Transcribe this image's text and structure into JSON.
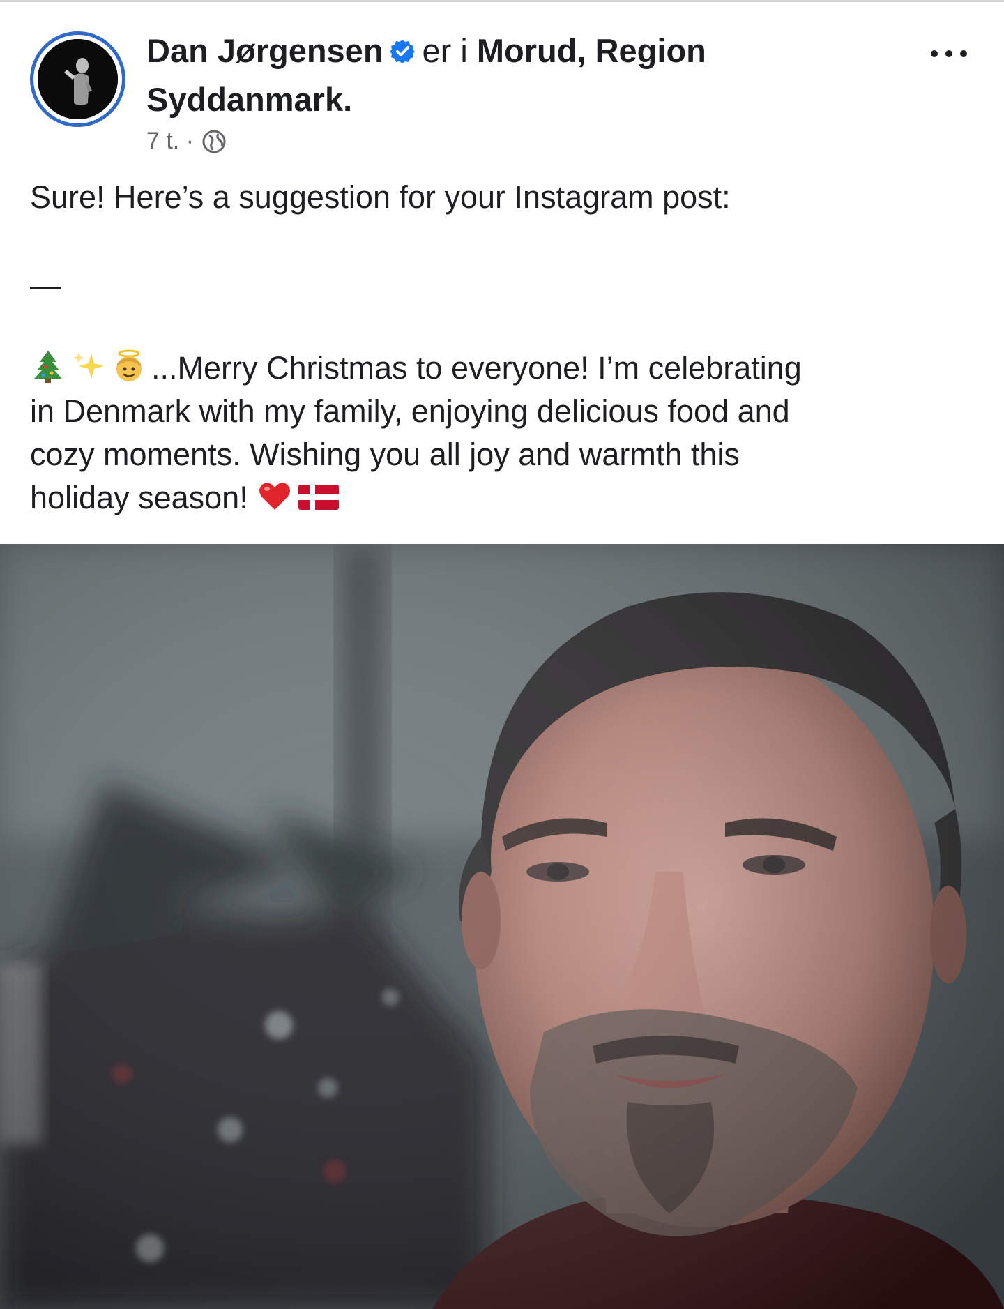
{
  "post": {
    "author": "Dan Jørgensen",
    "location_prefix": "er i",
    "location_line1": "Morud, Region",
    "location_line2": "Syddanmark.",
    "time": "7 t.",
    "separator": "·",
    "intro": "Sure! Here’s a suggestion for your Instagram post:",
    "dash": "—",
    "message_line1": "...Merry Christmas to everyone! I’m celebrating",
    "message_line2": "in Denmark with my family, enjoying delicious food and",
    "message_line3": "cozy moments. Wishing you all joy and warmth this",
    "message_line4": "holiday season!"
  },
  "icons": {
    "verified": "verified-badge-icon",
    "globe": "globe-icon",
    "more": "more-options-icon",
    "tree": "christmas-tree-icon",
    "sparkles": "sparkles-icon",
    "angel": "angel-icon",
    "heart": "heart-icon",
    "flag": "denmark-flag-icon"
  },
  "colors": {
    "text": "#1c1e21",
    "meta": "#65676b",
    "verified_blue": "#1877f2",
    "avatar_ring": "#2f69c9",
    "heart_red": "#e0242b",
    "flag_red": "#c8102e"
  }
}
